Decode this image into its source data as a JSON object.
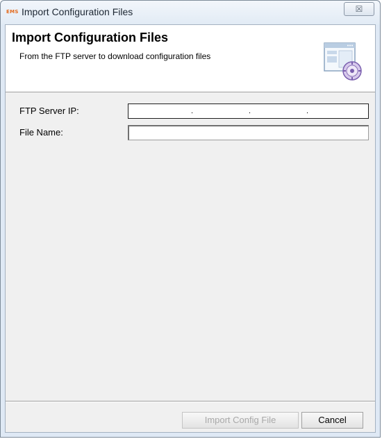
{
  "window": {
    "app_icon_text": "EMS",
    "title": "Import Configuration Files",
    "close_glyph": "☒"
  },
  "header": {
    "title": "Import Configuration Files",
    "description": "From the FTP server to download configuration files",
    "icon": "config-window-icon"
  },
  "form": {
    "ftp_ip_label": "FTP Server IP:",
    "ftp_ip_value": [
      "",
      "",
      "",
      ""
    ],
    "ip_separator": ".",
    "file_name_label": "File Name:",
    "file_name_value": ""
  },
  "buttons": {
    "import_label": "Import Config File",
    "import_enabled": false,
    "cancel_label": "Cancel"
  }
}
